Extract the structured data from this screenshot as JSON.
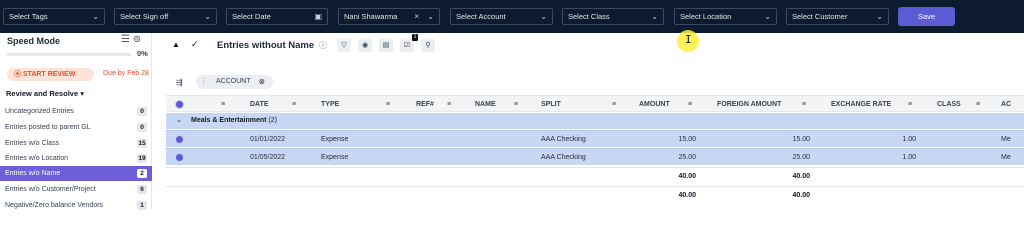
{
  "filters": {
    "tags": "Select Tags",
    "signoff": "Select Sign off",
    "date": "Select Date",
    "name": "Nani Shawarma",
    "account": "Select Account",
    "class": "Select Class",
    "location": "Select Location",
    "customer": "Select Customer",
    "save": "Save"
  },
  "sidebar": {
    "mode_title": "Speed Mode",
    "progress_pct": "0%",
    "progress_value": 0,
    "start_review": "START REVIEW",
    "due": "Due by Feb 28",
    "section": "Review and Resolve",
    "items": [
      {
        "label": "Uncategorized Entries",
        "count": "0"
      },
      {
        "label": "Entries posted to parent GL",
        "count": "0"
      },
      {
        "label": "Entries w/o Class",
        "count": "15"
      },
      {
        "label": "Entries w/o Location",
        "count": "19"
      },
      {
        "label": "Entries w/o Name",
        "count": "2"
      },
      {
        "label": "Entries w/o Customer/Project",
        "count": "6"
      },
      {
        "label": "Negative/Zero balance Vendors",
        "count": "1"
      }
    ]
  },
  "main": {
    "title": "Entries without Name",
    "tool_badge": "1",
    "group_chip": "ACCOUNT"
  },
  "table": {
    "columns": [
      "DATE",
      "TYPE",
      "REF#",
      "NAME",
      "SPLIT",
      "AMOUNT",
      "FOREIGN AMOUNT",
      "EXCHANGE RATE",
      "CLASS",
      "AC"
    ],
    "group": {
      "label": "Meals & Entertainment",
      "count": "(2)"
    },
    "rows": [
      {
        "date": "01/01/2022",
        "type": "Expense",
        "split": "AAA Checking",
        "amount": "15.00",
        "foreign": "15.00",
        "rate": "1.00",
        "ac": "Me"
      },
      {
        "date": "01/05/2022",
        "type": "Expense",
        "split": "AAA Checking",
        "amount": "25.00",
        "foreign": "25.00",
        "rate": "1.00",
        "ac": "Me"
      }
    ],
    "totals": [
      {
        "amount": "40.00",
        "foreign": "40.00"
      },
      {
        "amount": "40.00",
        "foreign": "40.00"
      }
    ]
  },
  "colors": {
    "topbar": "#0d1b2e",
    "accent": "#5b5bd6",
    "selected_row": "#c8d7f3",
    "review": "#e0522f"
  }
}
